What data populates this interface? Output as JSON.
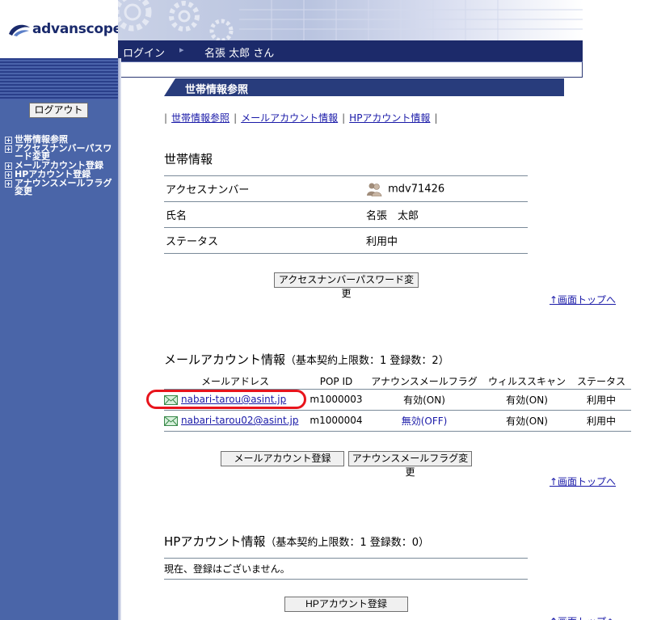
{
  "header": {
    "logo_text": "advanscope",
    "login_label": "ログイン",
    "arrow": "▸",
    "user_name": "名張 太郎 さん"
  },
  "sidebar": {
    "logout_label": "ログアウト",
    "items": [
      {
        "label": "世帯情報参照"
      },
      {
        "label": "アクセスナンバーパスワード変更"
      },
      {
        "label": "メールアカウント登録"
      },
      {
        "label": "HPアカウント登録"
      },
      {
        "label": "アナウンスメールフラグ変更"
      }
    ]
  },
  "main": {
    "page_title": "世帯情報参照",
    "subnav": [
      "世帯情報参照",
      "メールアカウント情報",
      "HPアカウント情報"
    ],
    "subnav_sep": "|",
    "household": {
      "title": "世帯情報",
      "rows": [
        {
          "label": "アクセスナンバー",
          "value": "mdv71426",
          "icon": "users-icon"
        },
        {
          "label": "氏名",
          "value": "名張　太郎"
        },
        {
          "label": "ステータス",
          "value": "利用中"
        }
      ],
      "button": "アクセスナンバーパスワード変更"
    },
    "top_link": "↑画面トップへ",
    "mail": {
      "title": "メールアカウント情報",
      "subtitle": "（基本契約上限数：1 登録数：2）",
      "columns": [
        "メールアドレス",
        "POP ID",
        "アナウンスメールフラグ",
        "ウィルススキャン",
        "ステータス"
      ],
      "rows": [
        {
          "email": "nabari-tarou@asint.jp",
          "pop_id": "m1000003",
          "flag": "有効(ON)",
          "scan": "有効(ON)",
          "status": "利用中"
        },
        {
          "email": "nabari-tarou02@asint.jp",
          "pop_id": "m1000004",
          "flag": "無効(OFF)",
          "scan": "有効(ON)",
          "status": "利用中"
        }
      ],
      "register_button": "メールアカウント登録",
      "flag_button": "アナウンスメールフラグ変更"
    },
    "hp": {
      "title": "HPアカウント情報",
      "subtitle": "（基本契約上限数：1 登録数：0）",
      "empty_message": "現在、登録はございません。",
      "register_button": "HPアカウント登録"
    }
  },
  "colors": {
    "sidebar": "#4a65a8",
    "header_bar": "#1c2a6a",
    "link": "#1a1aa8",
    "flag_off": "#1a1aa8",
    "highlight": "#e8141c"
  }
}
